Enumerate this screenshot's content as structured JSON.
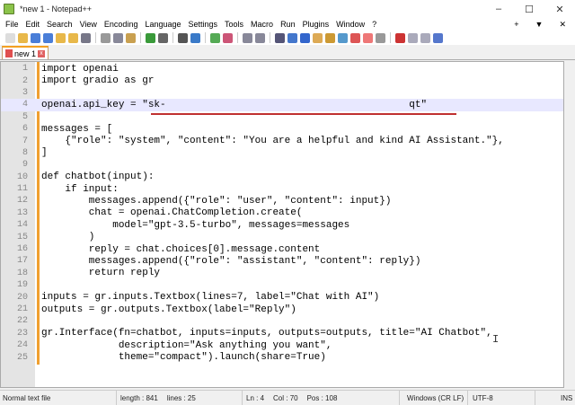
{
  "window": {
    "title": "*new 1 - Notepad++",
    "minimize": "–",
    "maximize": "☐",
    "close": "✕"
  },
  "menu": [
    "File",
    "Edit",
    "Search",
    "View",
    "Encoding",
    "Language",
    "Settings",
    "Tools",
    "Macro",
    "Run",
    "Plugins",
    "Window",
    "?"
  ],
  "menu_right": {
    "plus": "+",
    "dropdown": "▼",
    "close": "✕"
  },
  "toolbar_icons": [
    "new",
    "open",
    "save",
    "save-all",
    "close",
    "close-all",
    "print",
    "cut",
    "copy",
    "paste",
    "undo",
    "redo",
    "find",
    "replace",
    "zoom-in",
    "zoom-out",
    "sync-v",
    "sync-h",
    "wrap",
    "all-chars",
    "indent-guide",
    "udl",
    "doc-map",
    "func-list",
    "folder-workspace",
    "monitor",
    "record",
    "stop",
    "play",
    "play-multi",
    "save-macro"
  ],
  "tab": {
    "label": "new 1",
    "close": "x"
  },
  "editor": {
    "current_line": 4,
    "lines": [
      "import openai",
      "import gradio as gr",
      "",
      "openai.api_key = \"sk-                                         qt\"",
      "",
      "messages = [",
      "    {\"role\": \"system\", \"content\": \"You are a helpful and kind AI Assistant.\"},",
      "]",
      "",
      "def chatbot(input):",
      "    if input:",
      "        messages.append({\"role\": \"user\", \"content\": input})",
      "        chat = openai.ChatCompletion.create(",
      "            model=\"gpt-3.5-turbo\", messages=messages",
      "        )",
      "        reply = chat.choices[0].message.content",
      "        messages.append({\"role\": \"assistant\", \"content\": reply})",
      "        return reply",
      "",
      "inputs = gr.inputs.Textbox(lines=7, label=\"Chat with AI\")",
      "outputs = gr.outputs.Textbox(label=\"Reply\")",
      "",
      "gr.Interface(fn=chatbot, inputs=inputs, outputs=outputs, title=\"AI Chatbot\",",
      "             description=\"Ask anything you want\",",
      "             theme=\"compact\").launch(share=True)"
    ]
  },
  "status": {
    "type": "Normal text file",
    "length": "length : 841",
    "lines": "lines : 25",
    "ln": "Ln : 4",
    "col": "Col : 70",
    "pos": "Pos : 108",
    "eol": "Windows (CR LF)",
    "encoding": "UTF-8",
    "mode": "INS"
  }
}
